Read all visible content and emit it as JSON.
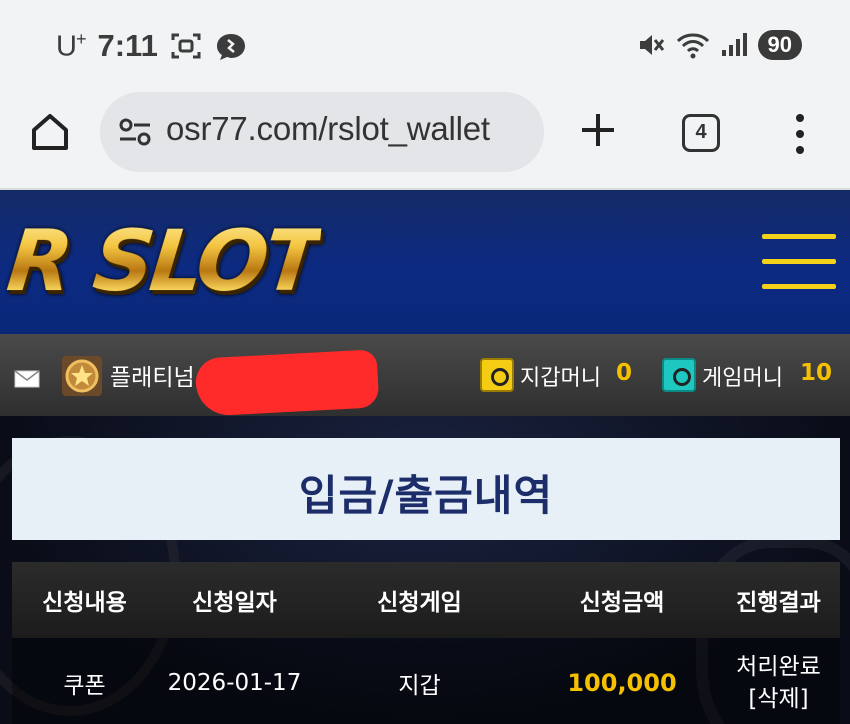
{
  "status_bar": {
    "carrier": "U",
    "carrier_sup": "+",
    "time": "7:11",
    "battery": "90"
  },
  "browser": {
    "url": "osr77.com/rslot_wallet",
    "tab_count": "4"
  },
  "site": {
    "logo": "R SLOT"
  },
  "user": {
    "grade": "플래티넘",
    "wallet_label": "지갑머니",
    "wallet_value": "0",
    "game_label": "게임머니",
    "game_value": "10"
  },
  "page": {
    "title": "입금/출금내역"
  },
  "table": {
    "headers": [
      "신청내용",
      "신청일자",
      "신청게임",
      "신청금액",
      "진행결과"
    ],
    "rows": [
      {
        "type": "쿠폰",
        "date": "2026-01-17",
        "game": "지갑",
        "amount": "100,000",
        "status": "처리완료",
        "action": "[삭제]"
      }
    ]
  },
  "colors": {
    "header_blue": "#0c2a82",
    "accent_gold": "#f5c000",
    "title_text": "#1d2d6a"
  }
}
